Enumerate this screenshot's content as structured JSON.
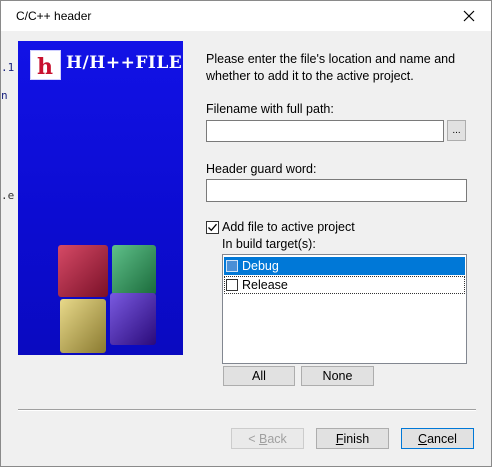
{
  "window": {
    "title": "C/C++ header"
  },
  "background_fragments": {
    "top": ".1",
    "mid": "n",
    "low": ".e"
  },
  "banner": {
    "logo_letter": "h",
    "title": "H/H++FILE"
  },
  "form": {
    "intro": "Please enter the file's location and name and whether to add it to the active project.",
    "filename_label": "Filename with full path:",
    "filename_value": "",
    "browse_label": "...",
    "guard_label": "Header guard word:",
    "guard_value": "",
    "add_to_project_label": "Add file to active project",
    "add_to_project_checked": true,
    "build_targets_label": "In build target(s):",
    "build_targets": [
      {
        "label": "Debug",
        "checked": false,
        "selected": true
      },
      {
        "label": "Release",
        "checked": false,
        "selected": false
      }
    ],
    "all_label": "All",
    "none_label": "None"
  },
  "footer": {
    "back_prefix": "< ",
    "back_mnemonic": "B",
    "back_rest": "ack",
    "finish_mnemonic": "F",
    "finish_rest": "inish",
    "cancel_mnemonic": "C",
    "cancel_rest": "ancel"
  },
  "colors": {
    "banner_blue": "#1212e6",
    "selection_blue": "#0078d7",
    "cube_red": "#b0203a",
    "cube_green": "#2e9a5a",
    "cube_yellow": "#c8b450",
    "cube_purple": "#4a22b8"
  }
}
